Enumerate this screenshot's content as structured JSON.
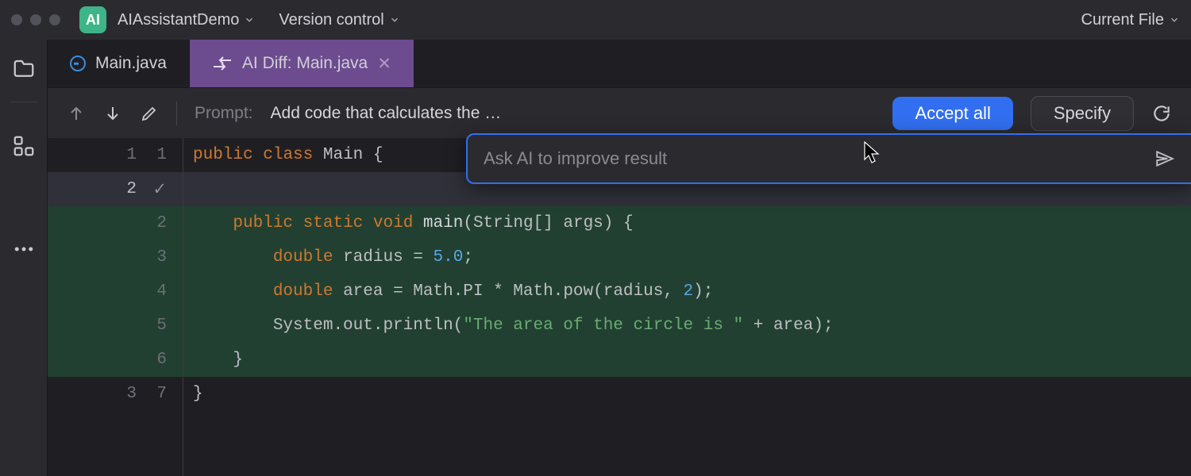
{
  "topbar": {
    "ai_badge": "AI",
    "project_name": "AIAssistantDemo",
    "vc_label": "Version control",
    "current_file": "Current File"
  },
  "tabs": {
    "file_tab": "Main.java",
    "diff_tab": "AI Diff: Main.java"
  },
  "difftoolbar": {
    "prompt_label": "Prompt: ",
    "prompt_text": "Add code that calculates the …",
    "accept_all": "Accept all",
    "specify": "Specify"
  },
  "ai_popup": {
    "placeholder": "Ask AI to improve result"
  },
  "gutter": [
    {
      "l": "1",
      "r": "1",
      "cls": ""
    },
    {
      "l": "2",
      "r": "",
      "cls": "cur check"
    },
    {
      "l": "",
      "r": "2",
      "cls": "added"
    },
    {
      "l": "",
      "r": "3",
      "cls": "added"
    },
    {
      "l": "",
      "r": "4",
      "cls": "added"
    },
    {
      "l": "",
      "r": "5",
      "cls": "added"
    },
    {
      "l": "",
      "r": "6",
      "cls": "added"
    },
    {
      "l": "3",
      "r": "7",
      "cls": ""
    }
  ],
  "code": {
    "line1": {
      "kw1": "public",
      "kw2": "class",
      "id": "Main",
      "brace": "{"
    },
    "line3": {
      "kw1": "public",
      "kw2": "static",
      "kw3": "void",
      "id": "main",
      "sig": "(String[] args) {"
    },
    "line4": {
      "kw": "double",
      "id": "radius",
      "eq": " = ",
      "num": "5.0",
      "semi": ";"
    },
    "line5": {
      "kw": "double",
      "id": "area",
      "rest": " = Math.PI * Math.pow(radius, ",
      "num": "2",
      "tail": ");"
    },
    "line6": {
      "head": "System.out.println(",
      "str": "\"The area of the circle is \"",
      "tail": " + area);"
    },
    "line7": "    }",
    "line8": "}"
  }
}
